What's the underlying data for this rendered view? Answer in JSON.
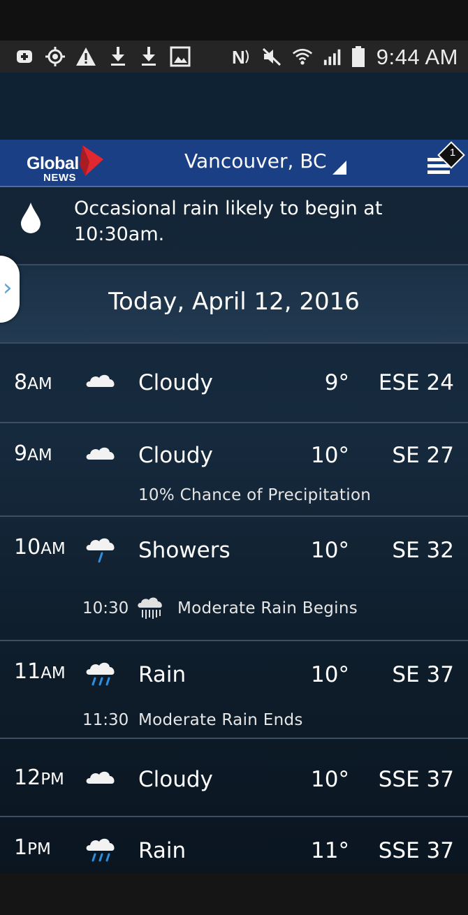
{
  "status_bar": {
    "time": "9:44 AM",
    "icons": [
      "add-box-icon",
      "gps-icon",
      "warning-icon",
      "download-icon",
      "download-icon",
      "image-icon",
      "nfc-icon",
      "mute-icon",
      "wifi-icon",
      "signal-icon",
      "battery-icon"
    ]
  },
  "header": {
    "logo_line1": "Global",
    "logo_line2": "NEWS",
    "location": "Vancouver, BC",
    "notification_count": "1"
  },
  "alert": {
    "text": "Occasional rain likely to begin at 10:30am.",
    "icon": "raindrop-icon"
  },
  "date_header": "Today, April 12, 2016",
  "hours": [
    {
      "hour": "8",
      "period": "AM",
      "icon": "cloud-icon",
      "condition": "Cloudy",
      "temp": "9°",
      "wind": "ESE 24"
    },
    {
      "hour": "9",
      "period": "AM",
      "icon": "cloud-icon",
      "condition": "Cloudy",
      "temp": "10°",
      "wind": "SE 27",
      "note": "10% Chance of Precipitation"
    },
    {
      "hour": "10",
      "period": "AM",
      "icon": "showers-icon",
      "condition": "Showers",
      "temp": "10°",
      "wind": "SE 32",
      "event_time": "10:30",
      "event_text": "Moderate Rain Begins"
    },
    {
      "hour": "11",
      "period": "AM",
      "icon": "rain-icon",
      "condition": "Rain",
      "temp": "10°",
      "wind": "SE 37",
      "event_time": "11:30",
      "event_text": "Moderate Rain Ends"
    },
    {
      "hour": "12",
      "period": "PM",
      "icon": "cloud-icon",
      "condition": "Cloudy",
      "temp": "10°",
      "wind": "SSE 37"
    },
    {
      "hour": "1",
      "period": "PM",
      "icon": "rain-icon",
      "condition": "Rain",
      "temp": "11°",
      "wind": "SSE 37"
    }
  ],
  "colors": {
    "header_blue": "#1b3f85",
    "logo_red": "#e0282e",
    "background_dark": "#112232",
    "accent_blue": "#5aa4d6",
    "rain_drop_blue": "#2e8fdc"
  }
}
